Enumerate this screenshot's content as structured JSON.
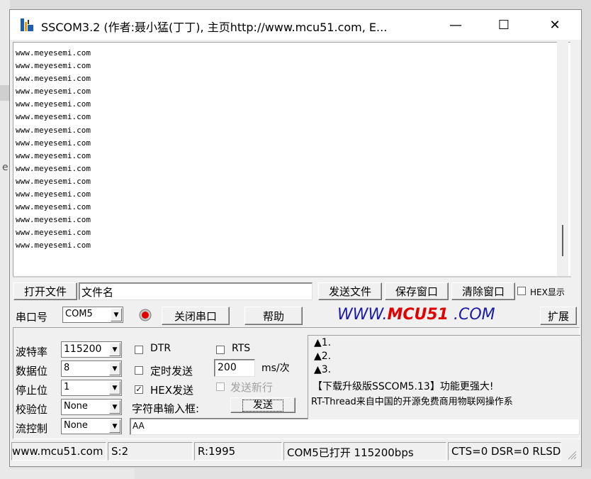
{
  "window": {
    "title": "SSCOM3.2 (作者:聂小猛(丁丁), 主页http://www.mcu51.com,  E...",
    "minimize": "—",
    "maximize": "☐",
    "close": "✕"
  },
  "background": {
    "edge_letter": "e"
  },
  "output": {
    "lines": [
      "www.meyesemi.com",
      "www.meyesemi.com",
      "www.meyesemi.com",
      "www.meyesemi.com",
      "www.meyesemi.com",
      "www.meyesemi.com",
      "www.meyesemi.com",
      "www.meyesemi.com",
      "www.meyesemi.com",
      "www.meyesemi.com",
      "www.meyesemi.com",
      "www.meyesemi.com",
      "www.meyesemi.com",
      "www.meyesemi.com",
      "www.meyesemi.com",
      "www.meyesemi.com"
    ]
  },
  "row1": {
    "open_file": "打开文件",
    "filename": "文件名",
    "send_file": "发送文件",
    "save_window": "保存窗口",
    "clear_window": "清除窗口",
    "hex_display": "HEX显示"
  },
  "row2": {
    "port_label": "串口号",
    "port_value": "COM5",
    "close_port": "关闭串口",
    "help": "帮助",
    "site_prefix": "WWW.",
    "site_brand": "MCU51",
    "site_suffix": " .COM",
    "expand": "扩展"
  },
  "settings": {
    "baud_label": "波特率",
    "baud_value": "115200",
    "data_bits_label": "数据位",
    "data_bits_value": "8",
    "stop_bits_label": "停止位",
    "stop_bits_value": "1",
    "parity_label": "校验位",
    "parity_value": "None",
    "flow_label": "流控制",
    "flow_value": "None"
  },
  "options": {
    "dtr": "DTR",
    "rts": "RTS",
    "timed_send": "定时发送",
    "interval": "200",
    "interval_unit": "ms/次",
    "hex_send": "HEX发送",
    "hex_send_checked": "✓",
    "send_newline": "发送新行",
    "input_label": "字符串输入框:",
    "send_button": "发送",
    "input_value": "AA"
  },
  "info": {
    "line1": "▲1.",
    "line2": "▲2.",
    "line3": "▲3.",
    "line4": "【下载升级版SSCOM5.13】功能更强大!",
    "line5": "RT-Thread来自中国的开源免费商用物联网操作系"
  },
  "statusbar": {
    "website": "www.mcu51.com",
    "sent": "S:2",
    "received": "R:1995",
    "port_state": "COM5已打开  115200bps",
    "signals": "CTS=0 DSR=0 RLSD=0"
  },
  "colors": {
    "brand_blue": "#1a1aa6",
    "brand_red": "#e00000",
    "led_red": "#e00000"
  }
}
